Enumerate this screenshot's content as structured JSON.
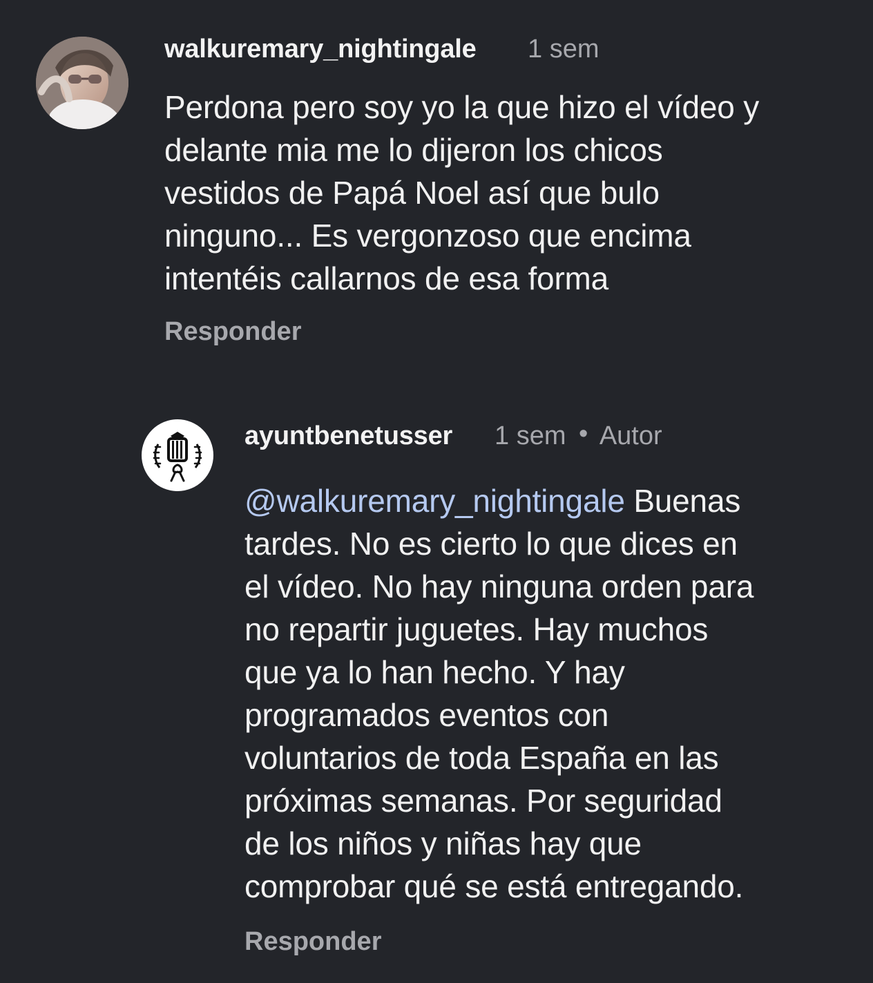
{
  "comments": [
    {
      "username": "walkuremary_nightingale",
      "time": "1 sem",
      "text": "Perdona pero soy yo la que hizo el vídeo y\ndelante mia me lo dijeron los chicos\nvestidos de Papá Noel así que bulo\nninguno... Es vergonzoso que encima\nintentéis callarnos de esa forma",
      "reply_label": "Responder"
    },
    {
      "username": "ayuntbenetusser",
      "time": "1 sem",
      "separator": "•",
      "author_label": "Autor",
      "mention": "@walkuremary_nightingale",
      "text_after_mention": " Buenas\ntardes. No es cierto lo que dices en\nel vídeo. No hay ninguna orden para\nno repartir juguetes. Hay muchos\nque ya lo han hecho. Y hay\nprogramados eventos con\nvoluntarios de toda España en las\npróximas semanas. Por seguridad\nde los niños y niñas hay que\ncomprobar qué se está entregando.",
      "reply_label": "Responder"
    }
  ]
}
